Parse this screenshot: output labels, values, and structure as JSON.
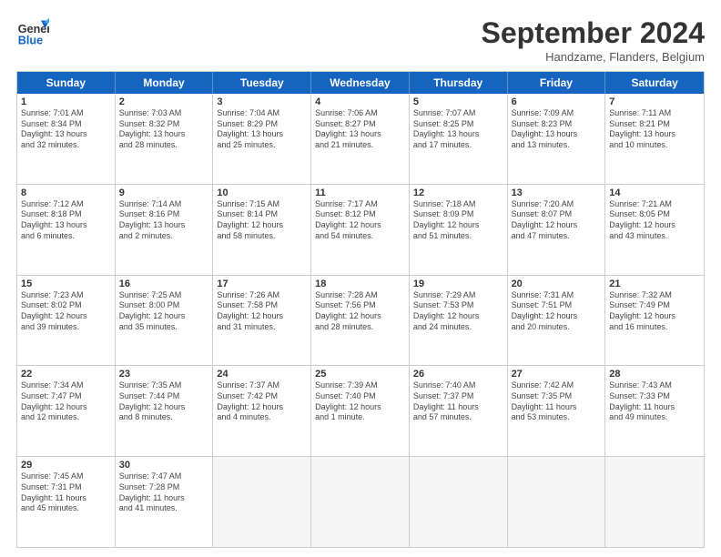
{
  "header": {
    "logo_line1": "General",
    "logo_line2": "Blue",
    "title": "September 2024",
    "subtitle": "Handzame, Flanders, Belgium"
  },
  "days_of_week": [
    "Sunday",
    "Monday",
    "Tuesday",
    "Wednesday",
    "Thursday",
    "Friday",
    "Saturday"
  ],
  "rows": [
    [
      {
        "day": "",
        "info": "",
        "empty": true
      },
      {
        "day": "2",
        "info": "Sunrise: 7:03 AM\nSunset: 8:32 PM\nDaylight: 13 hours\nand 28 minutes.",
        "empty": false
      },
      {
        "day": "3",
        "info": "Sunrise: 7:04 AM\nSunset: 8:29 PM\nDaylight: 13 hours\nand 25 minutes.",
        "empty": false
      },
      {
        "day": "4",
        "info": "Sunrise: 7:06 AM\nSunset: 8:27 PM\nDaylight: 13 hours\nand 21 minutes.",
        "empty": false
      },
      {
        "day": "5",
        "info": "Sunrise: 7:07 AM\nSunset: 8:25 PM\nDaylight: 13 hours\nand 17 minutes.",
        "empty": false
      },
      {
        "day": "6",
        "info": "Sunrise: 7:09 AM\nSunset: 8:23 PM\nDaylight: 13 hours\nand 13 minutes.",
        "empty": false
      },
      {
        "day": "7",
        "info": "Sunrise: 7:11 AM\nSunset: 8:21 PM\nDaylight: 13 hours\nand 10 minutes.",
        "empty": false
      }
    ],
    [
      {
        "day": "1",
        "info": "Sunrise: 7:01 AM\nSunset: 8:34 PM\nDaylight: 13 hours\nand 32 minutes.",
        "empty": false,
        "col_override": 0
      },
      {
        "day": "8",
        "info": "Sunrise: 7:12 AM\nSunset: 8:18 PM\nDaylight: 13 hours\nand 6 minutes.",
        "empty": false
      },
      {
        "day": "9",
        "info": "Sunrise: 7:14 AM\nSunset: 8:16 PM\nDaylight: 13 hours\nand 2 minutes.",
        "empty": false
      },
      {
        "day": "10",
        "info": "Sunrise: 7:15 AM\nSunset: 8:14 PM\nDaylight: 12 hours\nand 58 minutes.",
        "empty": false
      },
      {
        "day": "11",
        "info": "Sunrise: 7:17 AM\nSunset: 8:12 PM\nDaylight: 12 hours\nand 54 minutes.",
        "empty": false
      },
      {
        "day": "12",
        "info": "Sunrise: 7:18 AM\nSunset: 8:09 PM\nDaylight: 12 hours\nand 51 minutes.",
        "empty": false
      },
      {
        "day": "13",
        "info": "Sunrise: 7:20 AM\nSunset: 8:07 PM\nDaylight: 12 hours\nand 47 minutes.",
        "empty": false
      },
      {
        "day": "14",
        "info": "Sunrise: 7:21 AM\nSunset: 8:05 PM\nDaylight: 12 hours\nand 43 minutes.",
        "empty": false
      }
    ],
    [
      {
        "day": "15",
        "info": "Sunrise: 7:23 AM\nSunset: 8:02 PM\nDaylight: 12 hours\nand 39 minutes.",
        "empty": false
      },
      {
        "day": "16",
        "info": "Sunrise: 7:25 AM\nSunset: 8:00 PM\nDaylight: 12 hours\nand 35 minutes.",
        "empty": false
      },
      {
        "day": "17",
        "info": "Sunrise: 7:26 AM\nSunset: 7:58 PM\nDaylight: 12 hours\nand 31 minutes.",
        "empty": false
      },
      {
        "day": "18",
        "info": "Sunrise: 7:28 AM\nSunset: 7:56 PM\nDaylight: 12 hours\nand 28 minutes.",
        "empty": false
      },
      {
        "day": "19",
        "info": "Sunrise: 7:29 AM\nSunset: 7:53 PM\nDaylight: 12 hours\nand 24 minutes.",
        "empty": false
      },
      {
        "day": "20",
        "info": "Sunrise: 7:31 AM\nSunset: 7:51 PM\nDaylight: 12 hours\nand 20 minutes.",
        "empty": false
      },
      {
        "day": "21",
        "info": "Sunrise: 7:32 AM\nSunset: 7:49 PM\nDaylight: 12 hours\nand 16 minutes.",
        "empty": false
      }
    ],
    [
      {
        "day": "22",
        "info": "Sunrise: 7:34 AM\nSunset: 7:47 PM\nDaylight: 12 hours\nand 12 minutes.",
        "empty": false
      },
      {
        "day": "23",
        "info": "Sunrise: 7:35 AM\nSunset: 7:44 PM\nDaylight: 12 hours\nand 8 minutes.",
        "empty": false
      },
      {
        "day": "24",
        "info": "Sunrise: 7:37 AM\nSunset: 7:42 PM\nDaylight: 12 hours\nand 4 minutes.",
        "empty": false
      },
      {
        "day": "25",
        "info": "Sunrise: 7:39 AM\nSunset: 7:40 PM\nDaylight: 12 hours\nand 1 minute.",
        "empty": false
      },
      {
        "day": "26",
        "info": "Sunrise: 7:40 AM\nSunset: 7:37 PM\nDaylight: 11 hours\nand 57 minutes.",
        "empty": false
      },
      {
        "day": "27",
        "info": "Sunrise: 7:42 AM\nSunset: 7:35 PM\nDaylight: 11 hours\nand 53 minutes.",
        "empty": false
      },
      {
        "day": "28",
        "info": "Sunrise: 7:43 AM\nSunset: 7:33 PM\nDaylight: 11 hours\nand 49 minutes.",
        "empty": false
      }
    ],
    [
      {
        "day": "29",
        "info": "Sunrise: 7:45 AM\nSunset: 7:31 PM\nDaylight: 11 hours\nand 45 minutes.",
        "empty": false
      },
      {
        "day": "30",
        "info": "Sunrise: 7:47 AM\nSunset: 7:28 PM\nDaylight: 11 hours\nand 41 minutes.",
        "empty": false
      },
      {
        "day": "",
        "info": "",
        "empty": true
      },
      {
        "day": "",
        "info": "",
        "empty": true
      },
      {
        "day": "",
        "info": "",
        "empty": true
      },
      {
        "day": "",
        "info": "",
        "empty": true
      },
      {
        "day": "",
        "info": "",
        "empty": true
      }
    ]
  ]
}
